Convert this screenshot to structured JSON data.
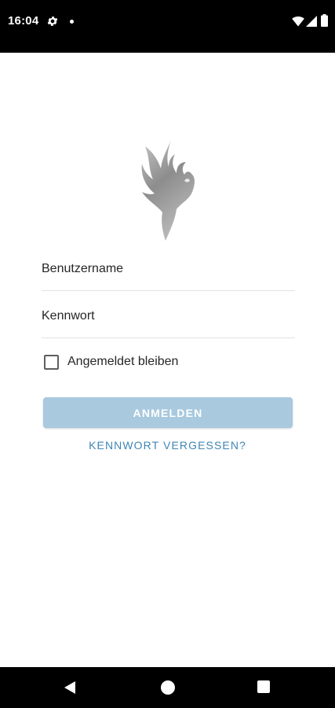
{
  "status_bar": {
    "time": "16:04",
    "icons": [
      "gear-icon",
      "notification-dot-icon",
      "wifi-icon",
      "signal-icon",
      "battery-icon"
    ]
  },
  "logo": {
    "icon": "phoenix-logo",
    "color": "#9a9a9a"
  },
  "form": {
    "username": {
      "placeholder": "Benutzername",
      "value": ""
    },
    "password": {
      "placeholder": "Kennwort",
      "value": ""
    },
    "remember_me": {
      "label": "Angemeldet bleiben",
      "checked": false
    },
    "login_label": "ANMELDEN",
    "forgot_label": "KENNWORT VERGESSEN?"
  },
  "colors": {
    "button_disabled": "#a8c9de",
    "link": "#3f86b4"
  },
  "nav_bar": {
    "icons": [
      "back-icon",
      "home-icon",
      "recents-icon"
    ]
  }
}
